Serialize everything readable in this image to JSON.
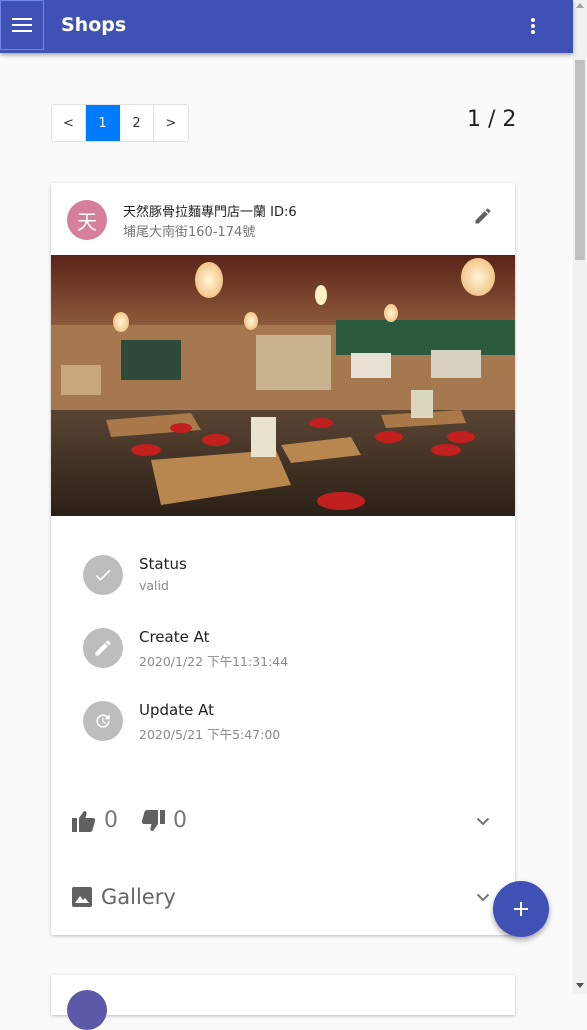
{
  "appbar": {
    "title": "Shops",
    "menu_icon": "menu-icon",
    "more_icon": "more-vert-icon",
    "color": "#3f51b5"
  },
  "pagination": {
    "prev": "<",
    "pages": [
      "1",
      "2"
    ],
    "next": ">",
    "current": "1",
    "indicator": "1 / 2",
    "active_color": "#007bff"
  },
  "shop": {
    "avatar_letter": "天",
    "avatar_color": "#d67f9a",
    "title": "天然豚骨拉麵專門店一蘭 ID:6",
    "address": "埔尾大南街160-174號",
    "edit_icon": "pencil-icon",
    "photo": "restaurant-interior-photo",
    "info": [
      {
        "icon": "check-icon",
        "label": "Status",
        "value": "valid"
      },
      {
        "icon": "pencil-icon",
        "label": "Create At",
        "value": "2020/1/22 下午11:31:44"
      },
      {
        "icon": "update-clock-icon",
        "label": "Update At",
        "value": "2020/5/21 下午5:47:00"
      }
    ],
    "likes": "0",
    "dislikes": "0",
    "gallery_label": "Gallery"
  },
  "fab": {
    "icon": "plus-icon"
  }
}
